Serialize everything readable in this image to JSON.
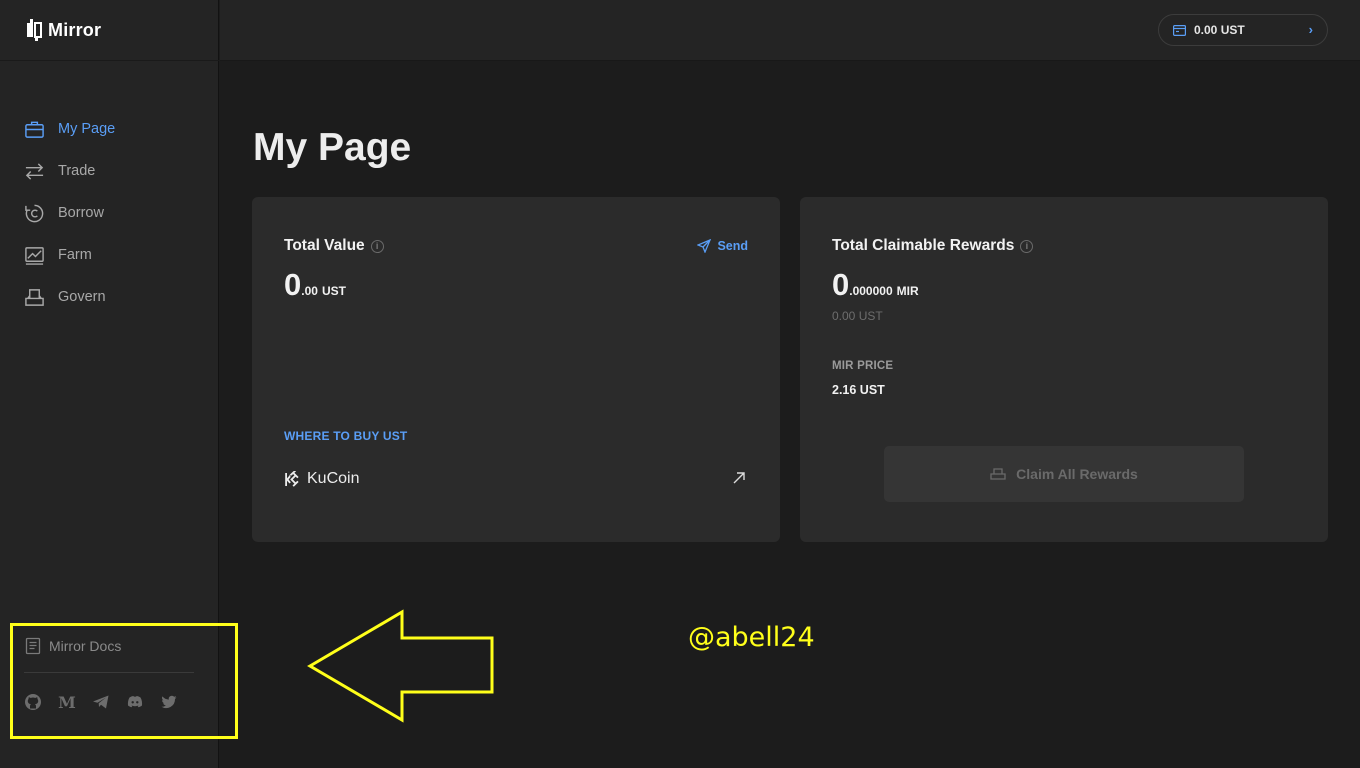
{
  "app": {
    "name": "Mirror"
  },
  "sidebar": {
    "items": [
      {
        "label": "My Page",
        "icon": "briefcase-icon",
        "active": true
      },
      {
        "label": "Trade",
        "icon": "swap-arrows-icon",
        "active": false
      },
      {
        "label": "Borrow",
        "icon": "borrow-icon",
        "active": false
      },
      {
        "label": "Farm",
        "icon": "chart-icon",
        "active": false
      },
      {
        "label": "Govern",
        "icon": "ballot-box-icon",
        "active": false
      }
    ],
    "docs_label": "Mirror Docs",
    "socials": [
      "github-icon",
      "medium-icon",
      "telegram-icon",
      "discord-icon",
      "twitter-icon"
    ]
  },
  "topbar": {
    "wallet_balance": "0.00 UST"
  },
  "main": {
    "title": "My Page",
    "total_value": {
      "title": "Total Value",
      "send_label": "Send",
      "value_int": "0",
      "value_dec": ".00",
      "unit": "UST",
      "where_to_buy_label": "WHERE TO BUY UST",
      "exchange_name": "KuCoin"
    },
    "rewards": {
      "title": "Total Claimable Rewards",
      "value_int": "0",
      "value_dec": ".000000",
      "unit": "MIR",
      "value_ust": "0.00 UST",
      "price_label": "MIR PRICE",
      "price_value": "2.16 UST",
      "claim_label": "Claim All Rewards"
    }
  },
  "annotation": {
    "watermark": "@abell24"
  },
  "colors": {
    "accent": "#5a9ef6",
    "highlight": "#ffff1a",
    "background": "#1c1c1c",
    "card": "#2b2b2b"
  }
}
